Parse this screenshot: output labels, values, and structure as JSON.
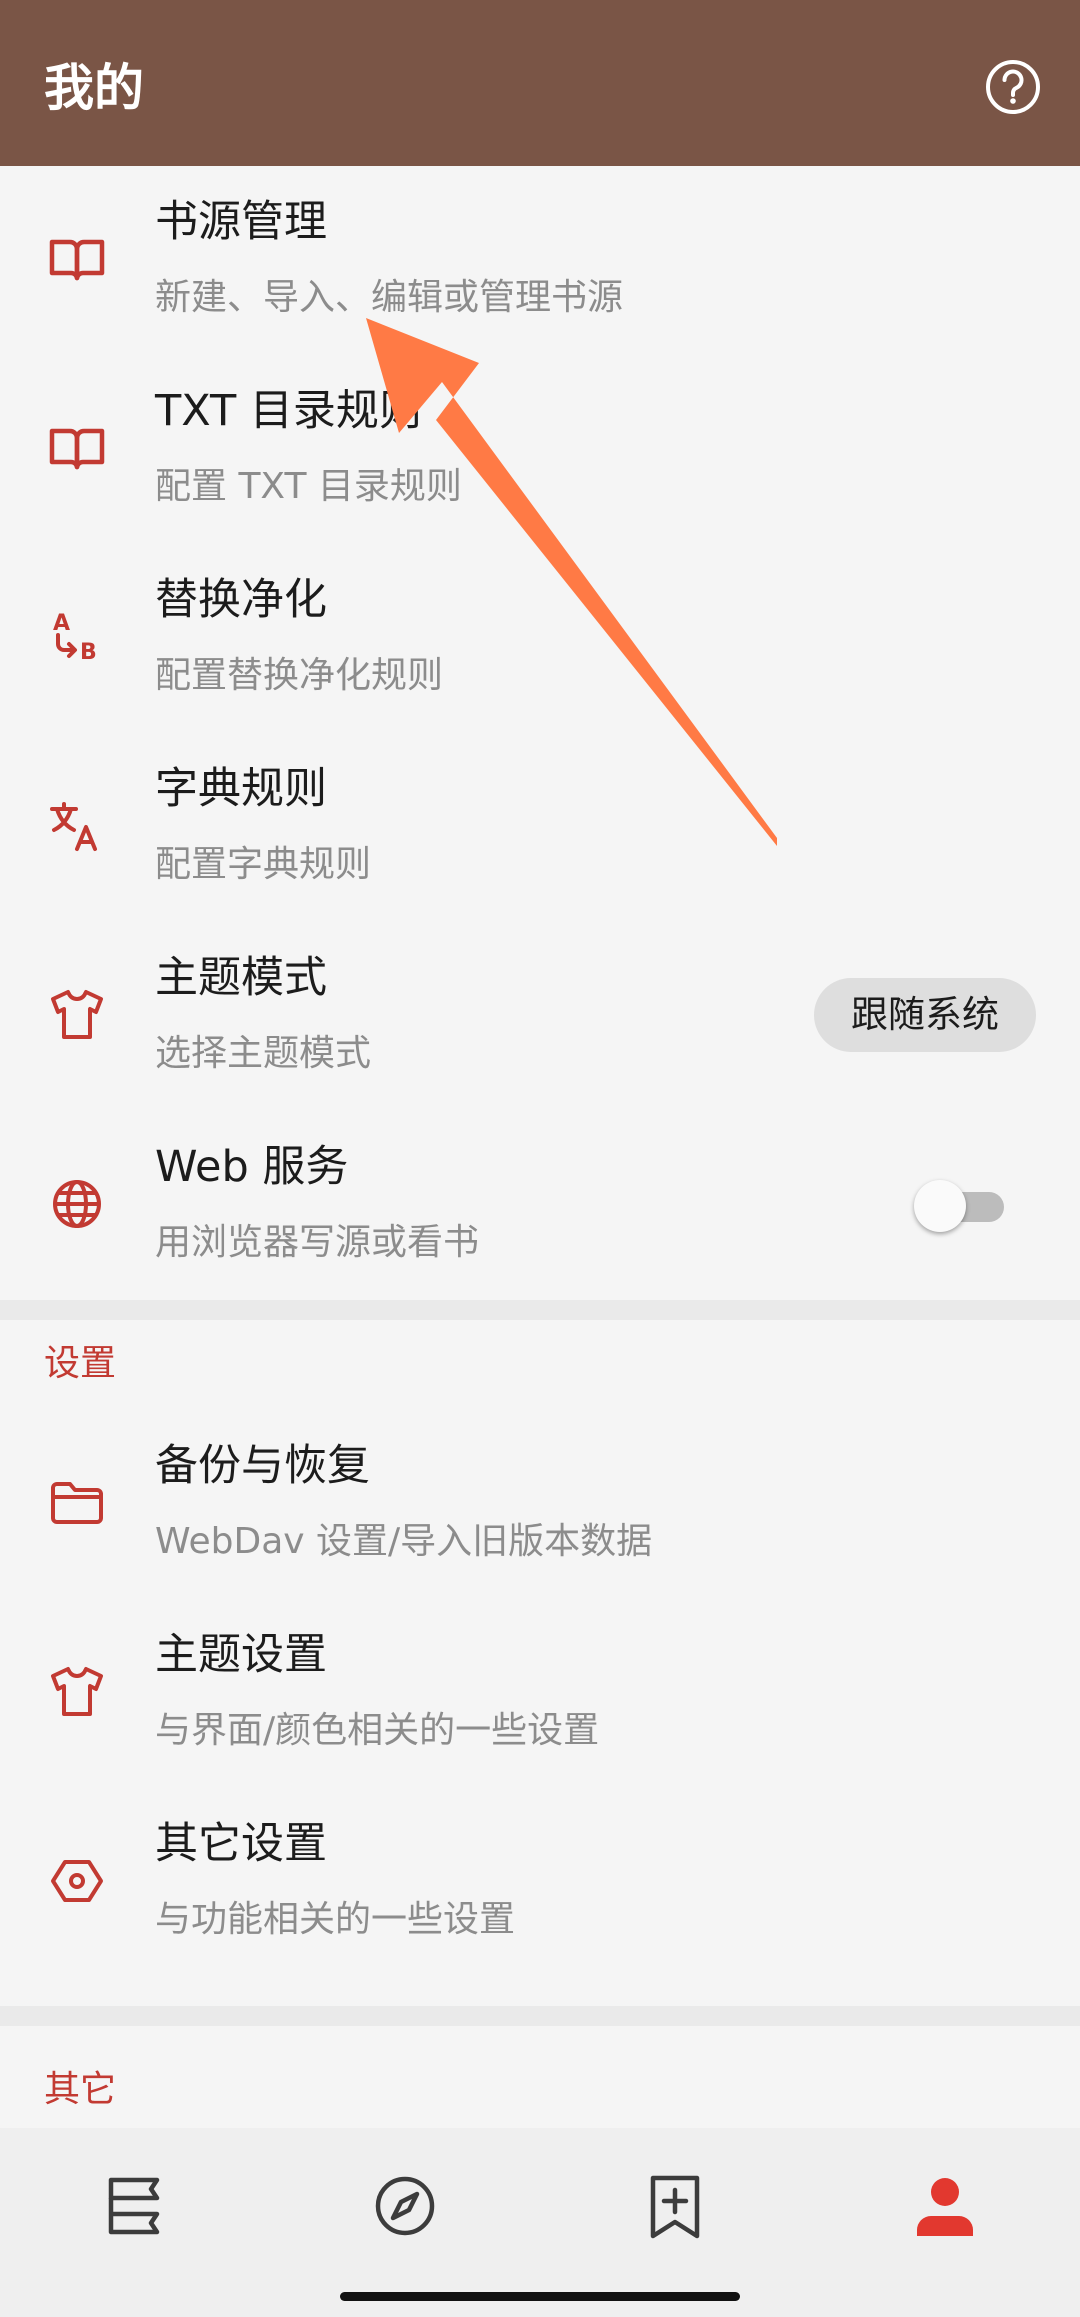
{
  "header": {
    "title": "我的",
    "help_icon": "help-circle-icon"
  },
  "main_items": [
    {
      "title": "书源管理",
      "subtitle": "新建、导入、编辑或管理书源",
      "icon": "book-open-icon"
    },
    {
      "title": "TXT 目录规则",
      "subtitle": "配置 TXT 目录规则",
      "icon": "book-open-icon"
    },
    {
      "title": "替换净化",
      "subtitle": "配置替换净化规则",
      "icon": "swap-ab-icon"
    },
    {
      "title": "字典规则",
      "subtitle": "配置字典规则",
      "icon": "translate-icon"
    },
    {
      "title": "主题模式",
      "subtitle": "选择主题模式",
      "icon": "tshirt-icon",
      "value": "跟随系统"
    },
    {
      "title": "Web 服务",
      "subtitle": "用浏览器写源或看书",
      "icon": "globe-icon",
      "toggle_on": false
    }
  ],
  "settings_section": {
    "title": "设置",
    "items": [
      {
        "title": "备份与恢复",
        "subtitle": "WebDav 设置/导入旧版本数据",
        "icon": "folder-icon"
      },
      {
        "title": "主题设置",
        "subtitle": "与界面/颜色相关的一些设置",
        "icon": "tshirt-icon"
      },
      {
        "title": "其它设置",
        "subtitle": "与功能相关的一些设置",
        "icon": "hexagon-settings-icon"
      }
    ]
  },
  "other_section": {
    "title": "其它"
  },
  "bottom_nav": [
    {
      "name": "bookshelf",
      "icon": "bookshelf-icon",
      "active": false
    },
    {
      "name": "discover",
      "icon": "compass-icon",
      "active": false
    },
    {
      "name": "rss",
      "icon": "bookmark-plus-icon",
      "active": false
    },
    {
      "name": "my",
      "icon": "person-icon",
      "active": true
    }
  ],
  "colors": {
    "toolbar": "#7a5546",
    "accent": "#c23a32",
    "annotation_arrow": "#ff7a45"
  }
}
